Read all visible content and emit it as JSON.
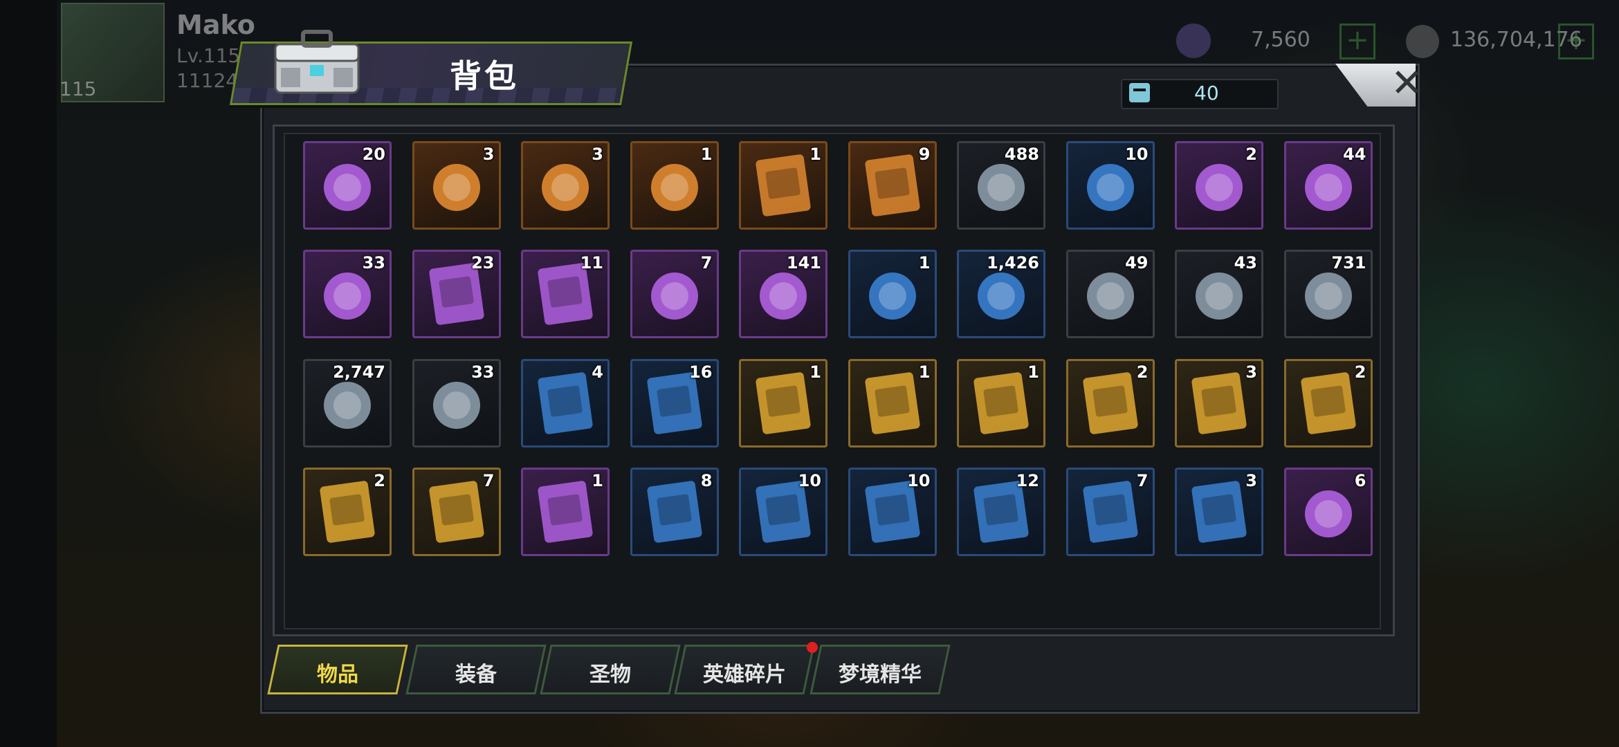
{
  "hud": {
    "player_name": "Mako",
    "player_level": "Lv.115",
    "player_power": "11124",
    "level_badge": "115",
    "gems": "7,560",
    "coins": "136,704,176",
    "plus": "+"
  },
  "panel": {
    "title": "背包",
    "capacity": "40",
    "close_symbol": "✕"
  },
  "colors": {
    "accent_yellow": "#f0d84a",
    "panel_border": "#3a4048",
    "rarity_gold": "#8a6a2a",
    "rarity_purple": "#6a3a8a",
    "rarity_blue": "#2a4a7a",
    "rarity_orange": "#7a4a1a"
  },
  "items": [
    {
      "name": "gem-chest-icon",
      "count": "20",
      "rarity": "purple"
    },
    {
      "name": "cube-box-icon",
      "count": "3",
      "rarity": "orange"
    },
    {
      "name": "triangle-prism-icon",
      "count": "3",
      "rarity": "orange"
    },
    {
      "name": "token-coin-icon",
      "count": "1",
      "rarity": "orange"
    },
    {
      "name": "gold-24h-card-icon",
      "count": "1",
      "rarity": "orange"
    },
    {
      "name": "gold-24h-g-card-icon",
      "count": "9",
      "rarity": "orange"
    },
    {
      "name": "red-lips-icon",
      "count": "488",
      "rarity": "dark"
    },
    {
      "name": "clover-coin-icon",
      "count": "10",
      "rarity": "blue"
    },
    {
      "name": "meat-leg-icon",
      "count": "2",
      "rarity": "purple"
    },
    {
      "name": "film-reel-icon",
      "count": "44",
      "rarity": "purple"
    },
    {
      "name": "spring-capsule-icon",
      "count": "33",
      "rarity": "purple"
    },
    {
      "name": "purple-12h-card-icon",
      "count": "23",
      "rarity": "purple"
    },
    {
      "name": "purple-12h-g-card-icon",
      "count": "11",
      "rarity": "purple"
    },
    {
      "name": "spade-chip-icon",
      "count": "7",
      "rarity": "purple"
    },
    {
      "name": "police-badge-icon",
      "count": "141",
      "rarity": "purple"
    },
    {
      "name": "dart-icon",
      "count": "1",
      "rarity": "blue"
    },
    {
      "name": "cinema-ticket-icon",
      "count": "1,426",
      "rarity": "blue"
    },
    {
      "name": "timer-chip-icon",
      "count": "49",
      "rarity": "dark"
    },
    {
      "name": "bottle-cap-icon",
      "count": "43",
      "rarity": "dark"
    },
    {
      "name": "red-chip-icon",
      "count": "731",
      "rarity": "dark"
    },
    {
      "name": "bullet-icon",
      "count": "2,747",
      "rarity": "dark"
    },
    {
      "name": "green-cap-icon",
      "count": "33",
      "rarity": "dark"
    },
    {
      "name": "blue-4h-card-icon",
      "count": "4",
      "rarity": "blue"
    },
    {
      "name": "blue-4h-g-card-icon",
      "count": "16",
      "rarity": "blue"
    },
    {
      "name": "gold-hat-blueprint-icon",
      "count": "1",
      "rarity": "gold"
    },
    {
      "name": "gold-boot-blueprint-icon",
      "count": "1",
      "rarity": "gold"
    },
    {
      "name": "gold-shirt-blueprint-icon",
      "count": "1",
      "rarity": "gold"
    },
    {
      "name": "gold-boot2-blueprint-icon",
      "count": "2",
      "rarity": "gold"
    },
    {
      "name": "gold-gun-blueprint-icon",
      "count": "3",
      "rarity": "gold"
    },
    {
      "name": "gold-sword-blueprint-icon",
      "count": "2",
      "rarity": "gold"
    },
    {
      "name": "gold-glasses-blueprint-icon",
      "count": "2",
      "rarity": "gold"
    },
    {
      "name": "gold-hat2-blueprint-icon",
      "count": "7",
      "rarity": "gold"
    },
    {
      "name": "purple-hat-blueprint-icon",
      "count": "1",
      "rarity": "purple"
    },
    {
      "name": "blue-hat-blueprint-icon",
      "count": "8",
      "rarity": "blue"
    },
    {
      "name": "blue-boot-blueprint-icon",
      "count": "10",
      "rarity": "blue"
    },
    {
      "name": "blue-sword-blueprint-icon",
      "count": "10",
      "rarity": "blue"
    },
    {
      "name": "blue-glasses-blueprint-icon",
      "count": "12",
      "rarity": "blue"
    },
    {
      "name": "blue-gun-blueprint-icon",
      "count": "7",
      "rarity": "blue"
    },
    {
      "name": "blue-shirt-blueprint-icon",
      "count": "3",
      "rarity": "blue"
    },
    {
      "name": "thumbs-up-icon",
      "count": "6",
      "rarity": "purple"
    }
  ],
  "tabs": [
    {
      "label": "物品",
      "active": true
    },
    {
      "label": "装备",
      "active": false
    },
    {
      "label": "圣物",
      "active": false
    },
    {
      "label": "英雄碎片",
      "active": false
    },
    {
      "label": "梦境精华",
      "active": false
    }
  ]
}
